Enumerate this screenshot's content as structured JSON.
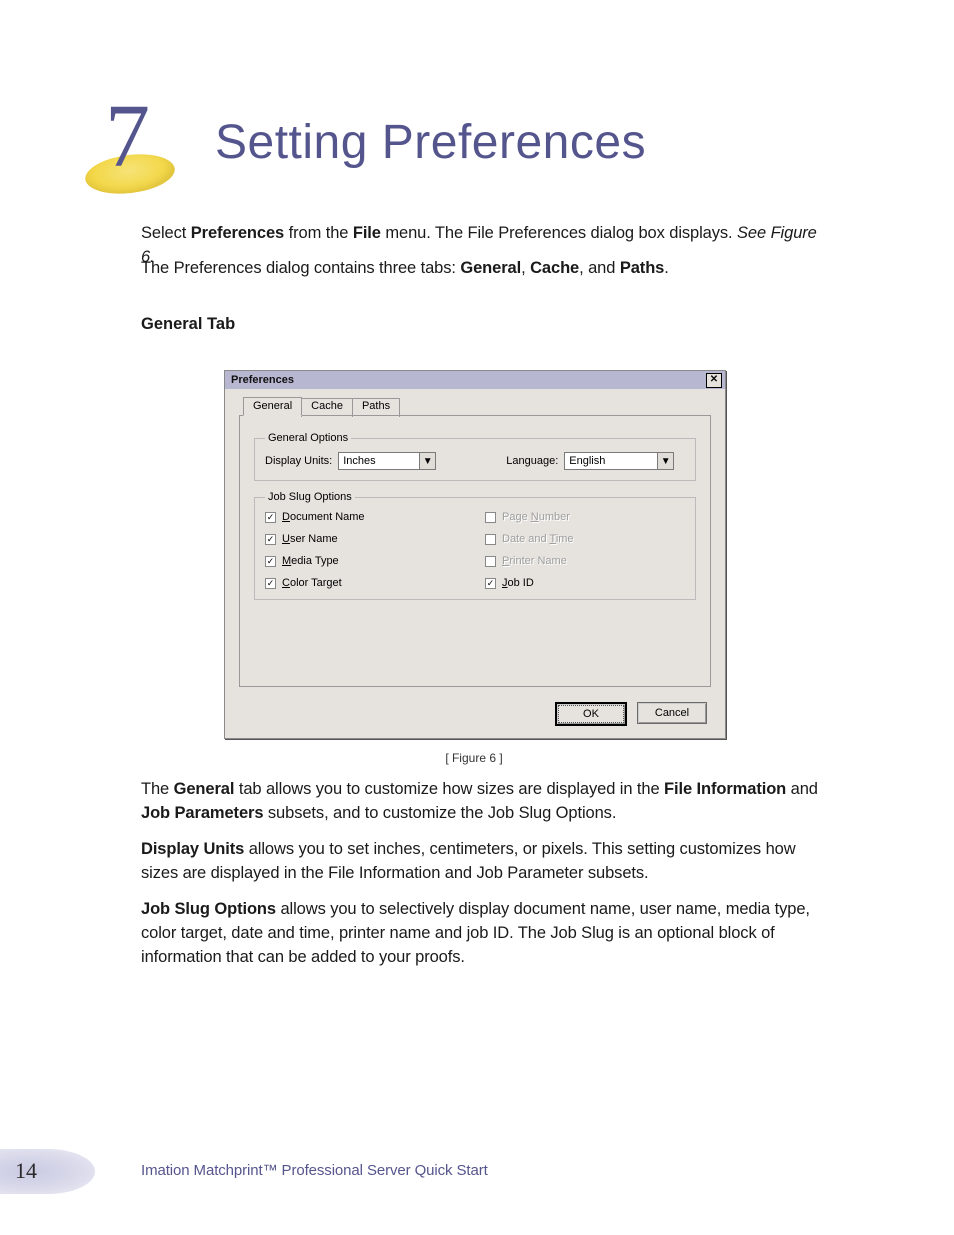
{
  "chapter": {
    "number": "7",
    "title": "Setting Preferences"
  },
  "intro": {
    "p1_a": "Select ",
    "p1_b": "Preferences",
    "p1_c": " from the ",
    "p1_d": "File",
    "p1_e": " menu. The File Preferences dialog box displays. ",
    "p1_f": "See Figure 6.",
    "p2_a": "The Preferences dialog contains three tabs: ",
    "p2_b": "General",
    "p2_c": ", ",
    "p2_d": "Cache",
    "p2_e": ", and ",
    "p2_f": "Paths",
    "p2_g": "."
  },
  "section_heading": "General Tab",
  "dialog": {
    "title": "Preferences",
    "close_icon": "✕",
    "tabs": {
      "general": "General",
      "cache": "Cache",
      "paths": "Paths"
    },
    "general_options": {
      "legend": "General Options",
      "display_units_label": "Display Units:",
      "display_units_value": "Inches",
      "language_label": "Language:",
      "language_value": "English"
    },
    "job_slug": {
      "legend": "Job Slug Options",
      "document_name": {
        "u": "D",
        "rest": "ocument Name",
        "checked": true,
        "disabled": false
      },
      "page_number": {
        "before": "Page ",
        "u": "N",
        "after": "umber",
        "checked": false,
        "disabled": true
      },
      "user_name": {
        "u": "U",
        "rest": "ser Name",
        "checked": true,
        "disabled": false
      },
      "date_time": {
        "before": "Date and ",
        "u": "T",
        "after": "ime",
        "checked": false,
        "disabled": true
      },
      "media_type": {
        "u": "M",
        "rest": "edia Type",
        "checked": true,
        "disabled": false
      },
      "printer_name": {
        "u": "P",
        "rest": "rinter Name",
        "checked": false,
        "disabled": true
      },
      "color_target": {
        "u": "C",
        "rest": "olor Target",
        "checked": true,
        "disabled": false
      },
      "job_id": {
        "u": "J",
        "rest": "ob ID",
        "checked": true,
        "disabled": false
      }
    },
    "buttons": {
      "ok": "OK",
      "cancel": "Cancel"
    }
  },
  "figure_caption": "[ Figure 6 ]",
  "body": {
    "p3_a": "The ",
    "p3_b": "General",
    "p3_c": " tab allows you to customize how sizes are displayed in the ",
    "p3_d": "File Information",
    "p3_e": " and ",
    "p3_f": "Job Parameters",
    "p3_g": " subsets, and to customize the Job Slug Options.",
    "p4_a": "Display Units",
    "p4_b": " allows you to set inches, centimeters, or pixels. This setting customizes how sizes are displayed in the File Information and Job Parameter subsets.",
    "p5_a": "Job Slug Options",
    "p5_b": " allows you to selectively display document name, user name, media type, color target, date and time, printer name and job ID. The Job Slug is an optional block of information that can be added to your proofs."
  },
  "footer": {
    "page_number": "14",
    "text": "Imation Matchprint™ Professional Server Quick Start"
  }
}
